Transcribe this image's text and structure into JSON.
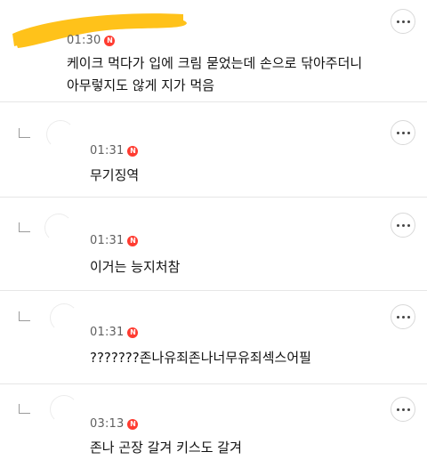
{
  "comments": [
    {
      "time": "01:30",
      "badge": "N",
      "text": "케이크 먹다가 입에 크림 묻었는데 손으로 닦아주더니\n아무렇지도 않게 지가 먹음"
    },
    {
      "time": "01:31",
      "badge": "N",
      "text": "무기징역"
    },
    {
      "time": "01:31",
      "badge": "N",
      "text": "이거는 능지처참"
    },
    {
      "time": "01:31",
      "badge": "N",
      "text": "???????존나유죄존나너무유죄섹스어필"
    },
    {
      "time": "03:13",
      "badge": "N",
      "text": "존나 곤장 갈겨 키스도 갈겨"
    }
  ],
  "colors": {
    "censor": "#ffc21a",
    "badge": "#ff3b30"
  },
  "icons": {
    "more": "more-horizontal-icon",
    "reply": "reply-arrow-icon",
    "new": "new-badge-icon"
  }
}
